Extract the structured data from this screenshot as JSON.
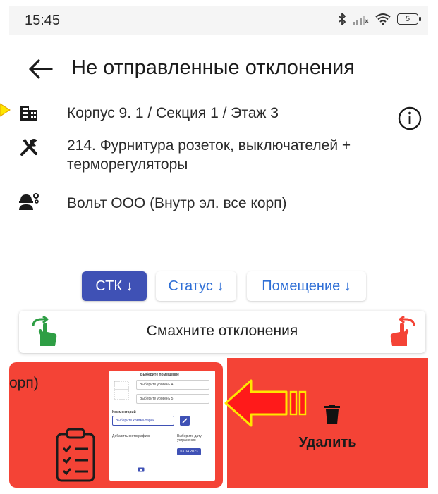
{
  "status_bar": {
    "time": "15:45",
    "battery": "5"
  },
  "header": {
    "title": "Не отправленные отклонения"
  },
  "info": {
    "location": "Корпус 9. 1 / Секция 1 / Этаж 3",
    "work": "214. Фурнитура розеток, выключателей + терморегуляторы",
    "contractor": "Вольт ООО (Внутр эл. все корп)"
  },
  "filters": {
    "chips": [
      {
        "label": "СТК ↓",
        "active": true
      },
      {
        "label": "Статус ↓",
        "active": false
      },
      {
        "label": "Помещение ↓",
        "active": false
      }
    ]
  },
  "swipe": {
    "hint": "Смахните отклонения"
  },
  "card": {
    "partial_text": "орп)",
    "preview": {
      "room_title": "Выберите помещение",
      "level4": "Выберите уровень 4",
      "level5": "Выберите уровень 5",
      "comment_title": "Комментарий",
      "comment_placeholder": "Выберите комментарий",
      "add_photo": "Добавить фотографию",
      "due_date_title": "Выберите дату устранения",
      "due_date": "03.04.2023"
    },
    "delete_label": "Удалить"
  },
  "colors": {
    "accent": "#3f51b5",
    "chip_text": "#2f6fd6",
    "swipe_red": "#f44336",
    "swipe_green": "#2e9e44",
    "annotation_yellow": "#ffe600",
    "annotation_red": "#ff1a1a"
  }
}
